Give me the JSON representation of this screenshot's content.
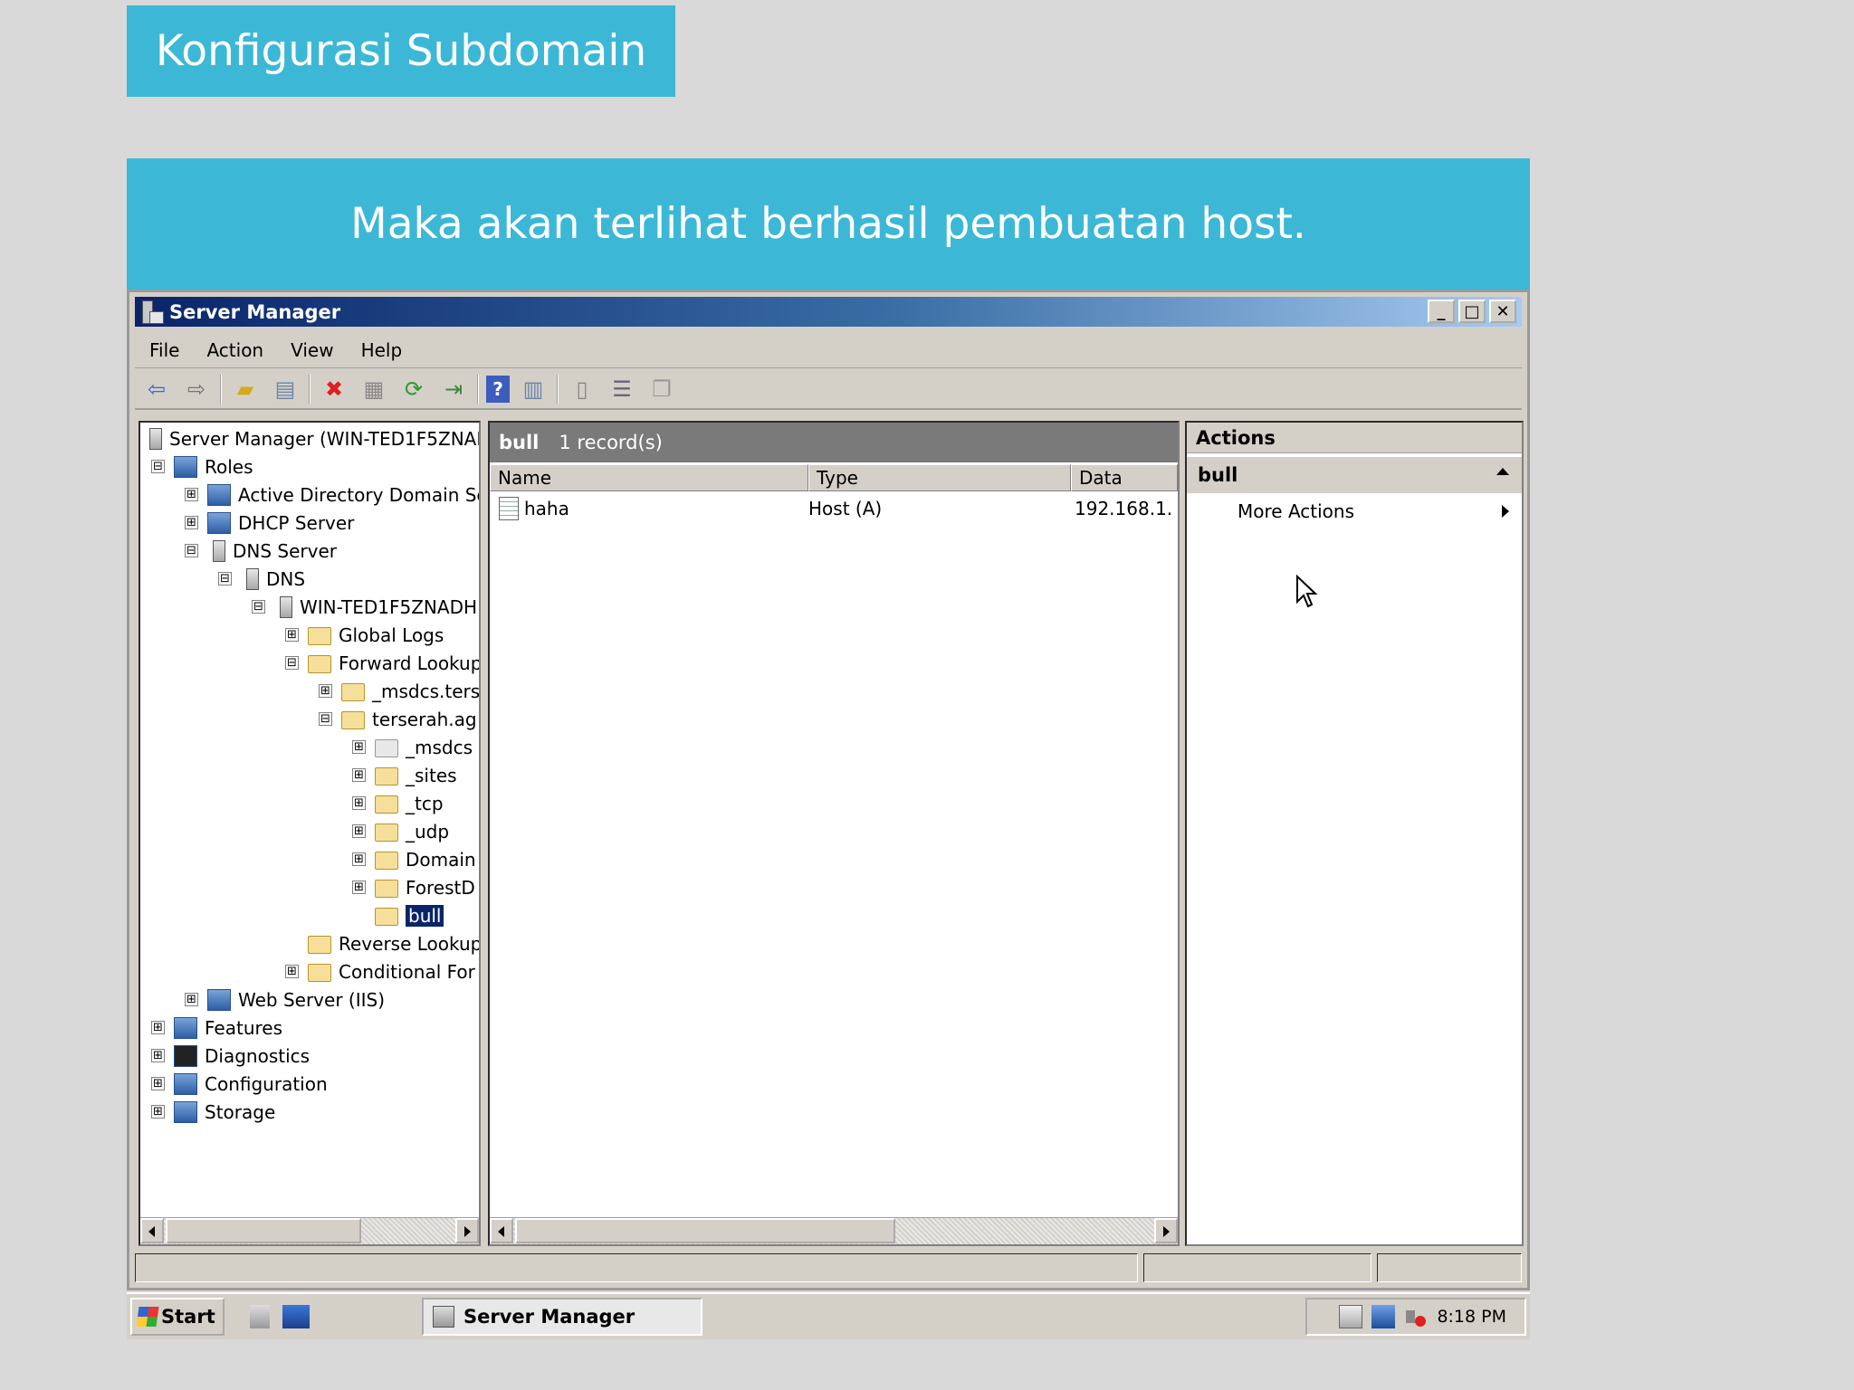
{
  "slide": {
    "title": "Konfigurasi Subdomain",
    "caption": "Maka akan terlihat berhasil pembuatan host."
  },
  "window": {
    "title": "Server Manager",
    "controls": {
      "minimize": "_",
      "maximize": "□",
      "close": "✕"
    }
  },
  "menu": [
    "File",
    "Action",
    "View",
    "Help"
  ],
  "toolbar_icons": [
    "back-icon",
    "forward-icon",
    "up-folder-icon",
    "show-hide-console-tree-icon",
    "delete-icon",
    "properties-icon",
    "refresh-icon",
    "export-list-icon",
    "help-icon",
    "show-action-pane-icon",
    "server-icon",
    "records-icon",
    "copy-icon"
  ],
  "tree": {
    "items": [
      {
        "label": "Server Manager (WIN-TED1F5ZNAD",
        "level": 0,
        "expander": "",
        "icon": "server-manager-icon"
      },
      {
        "label": "Roles",
        "level": 1,
        "expander": "⊟",
        "icon": "roles-icon"
      },
      {
        "label": "Active Directory Domain Se",
        "level": 2,
        "expander": "⊞",
        "icon": "ad-icon"
      },
      {
        "label": "DHCP Server",
        "level": 2,
        "expander": "⊞",
        "icon": "dhcp-icon"
      },
      {
        "label": "DNS Server",
        "level": 2,
        "expander": "⊟",
        "icon": "dns-server-icon"
      },
      {
        "label": "DNS",
        "level": 3,
        "expander": "⊟",
        "icon": "dns-icon"
      },
      {
        "label": "WIN-TED1F5ZNADH",
        "level": 4,
        "expander": "⊟",
        "icon": "server-icon"
      },
      {
        "label": "Global Logs",
        "level": 5,
        "expander": "⊞",
        "icon": "logs-icon"
      },
      {
        "label": "Forward Lookup",
        "level": 5,
        "expander": "⊟",
        "icon": "folder-icon"
      },
      {
        "label": "_msdcs.ters",
        "level": 6,
        "expander": "⊞",
        "icon": "zone-icon"
      },
      {
        "label": "terserah.ag",
        "level": 6,
        "expander": "⊟",
        "icon": "zone-icon"
      },
      {
        "label": "_msdcs",
        "level": 7,
        "expander": "⊞",
        "icon": "zone-icon"
      },
      {
        "label": "_sites",
        "level": 7,
        "expander": "⊞",
        "icon": "folder-icon"
      },
      {
        "label": "_tcp",
        "level": 7,
        "expander": "⊞",
        "icon": "folder-icon"
      },
      {
        "label": "_udp",
        "level": 7,
        "expander": "⊞",
        "icon": "folder-icon"
      },
      {
        "label": "Domain",
        "level": 7,
        "expander": "⊞",
        "icon": "folder-icon"
      },
      {
        "label": "ForestD",
        "level": 7,
        "expander": "⊞",
        "icon": "folder-icon"
      },
      {
        "label": "bull",
        "level": 7,
        "expander": "",
        "icon": "folder-icon",
        "selected": true
      },
      {
        "label": "Reverse Lookup",
        "level": 5,
        "expander": "",
        "icon": "folder-icon"
      },
      {
        "label": "Conditional For",
        "level": 5,
        "expander": "⊞",
        "icon": "folder-icon"
      },
      {
        "label": "Web Server (IIS)",
        "level": 2,
        "expander": "⊞",
        "icon": "iis-icon"
      },
      {
        "label": "Features",
        "level": 1,
        "expander": "⊞",
        "icon": "features-icon"
      },
      {
        "label": "Diagnostics",
        "level": 1,
        "expander": "⊞",
        "icon": "diagnostics-icon"
      },
      {
        "label": "Configuration",
        "level": 1,
        "expander": "⊞",
        "icon": "configuration-icon"
      },
      {
        "label": "Storage",
        "level": 1,
        "expander": "⊞",
        "icon": "storage-icon"
      }
    ]
  },
  "list": {
    "node": "bull",
    "count": "1 record(s)",
    "columns": [
      "Name",
      "Type",
      "Data"
    ],
    "rows": [
      {
        "name": "haha",
        "type": "Host (A)",
        "data": "192.168.1."
      }
    ]
  },
  "actions": {
    "header": "Actions",
    "section": "bull",
    "items": [
      "More Actions"
    ]
  },
  "taskbar": {
    "start": "Start",
    "task": "Server Manager",
    "clock": "8:18 PM"
  },
  "colors": {
    "slide_accent": "#3cb8d6",
    "titlebar_start": "#0a246a",
    "selection": "#0a246a"
  }
}
